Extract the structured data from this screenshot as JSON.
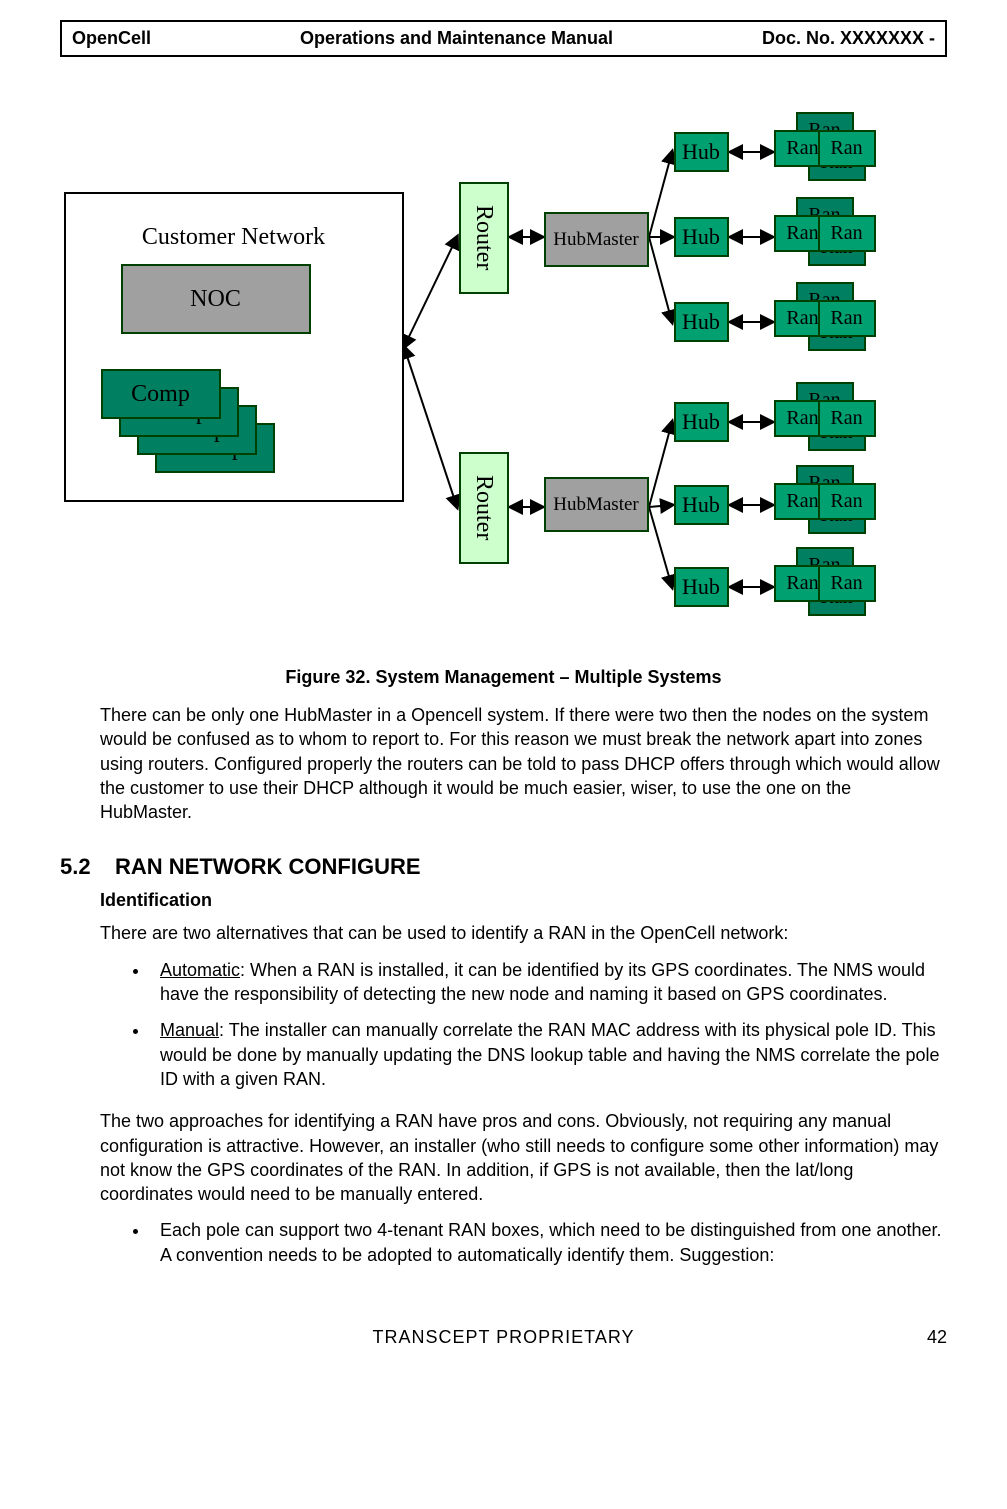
{
  "header": {
    "left": "OpenCell",
    "center": "Operations and Maintenance Manual",
    "right": "Doc. No.  XXXXXXX -"
  },
  "diagram": {
    "customer_title": "Customer Network",
    "noc": "NOC",
    "comp": "Comp",
    "router": "Router",
    "hubmaster": "HubMaster",
    "hub": "Hub",
    "ran": "Ran"
  },
  "caption": "Figure 32.  System Management – Multiple Systems",
  "para1": "There can be only one HubMaster in a Opencell system. If there were two then the nodes on the system would be confused as to whom to report to. For this reason we must break the network apart into zones using routers. Configured properly the routers can be told to pass DHCP offers through which would allow the customer to use their DHCP although it would be much easier, wiser, to use the one on the HubMaster.",
  "section": {
    "num": "5.2",
    "title": "RAN NETWORK CONFIGURE"
  },
  "subheading": "Identification",
  "para2": "There are two alternatives that can be used to identify a RAN in the OpenCell network:",
  "bullet1_label": "Automatic",
  "bullet1_text": ": When a RAN is installed, it can be identified by its GPS coordinates. The NMS would have the responsibility of detecting the new node and naming it based on GPS coordinates.",
  "bullet2_label": "Manual",
  "bullet2_text": ": The installer can manually correlate the RAN MAC address with its physical pole ID. This would be done by manually updating the DNS lookup table and having the NMS correlate the pole ID with a given RAN.",
  "para3": "The two approaches for identifying a RAN have pros and cons. Obviously, not requiring any manual configuration is attractive. However, an installer (who still needs to configure some other information) may not know the GPS coordinates of the RAN. In addition, if GPS is not available, then the lat/long coordinates would need to be manually entered.",
  "bullet3_text": "Each pole can support two 4-tenant RAN boxes, which need to be distinguished from one another. A convention needs to be adopted to automatically identify them. Suggestion:",
  "footer": {
    "center": "TRANSCEPT PROPRIETARY",
    "right": "42"
  }
}
